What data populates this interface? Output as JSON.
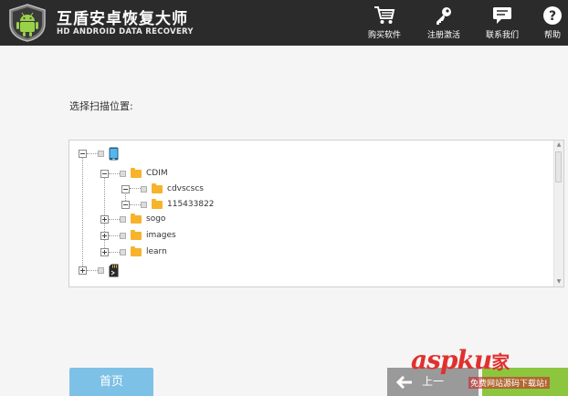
{
  "app": {
    "title_cn": "互盾安卓恢复大师",
    "title_en": "HD ANDROID DATA RECOVERY"
  },
  "header": {
    "buy_label": "购买软件",
    "register_label": "注册激活",
    "contact_label": "联系我们",
    "help_label": "帮助"
  },
  "main": {
    "prompt": "选择扫描位置:"
  },
  "tree": {
    "cdim": "CDIM",
    "cdvscscs": "cdvscscs",
    "num": "115433822",
    "sogo": "sogo",
    "images": "images",
    "learn": "learn"
  },
  "footer": {
    "home_label": "首页",
    "prev_label": "上一"
  },
  "watermark": {
    "text_a": "asp",
    "text_b": "ku",
    "text_c": "家",
    "sub": "免费网站源码下载站!"
  },
  "colors": {
    "header_bg": "#2b2b2b",
    "accent_blue": "#7ec1e6",
    "accent_green": "#8cc63f",
    "folder": "#f7b32b"
  }
}
